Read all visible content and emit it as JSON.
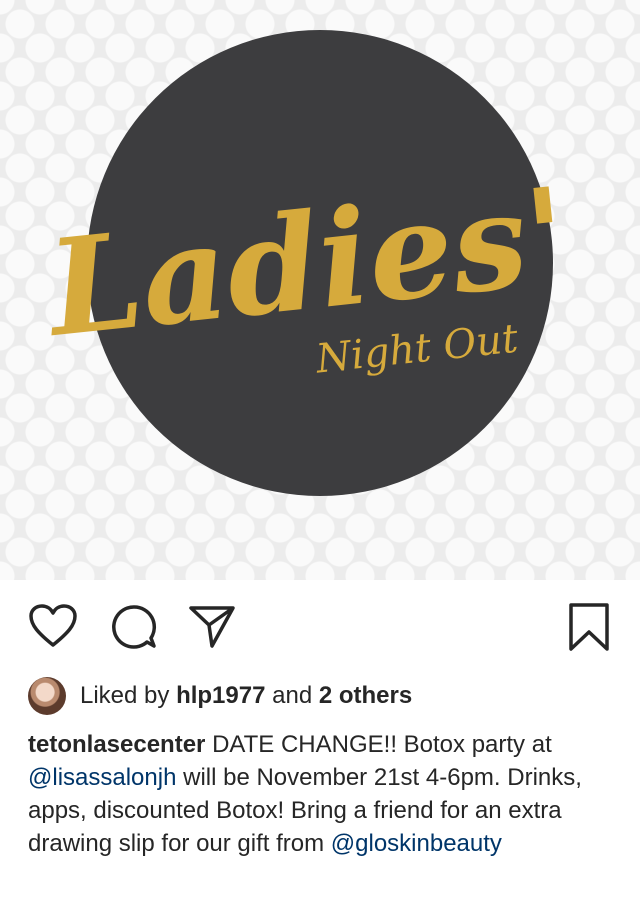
{
  "post": {
    "image": {
      "artwork_text_main": "Ladies'",
      "artwork_text_sub": "Night Out",
      "colors": {
        "circle": "#3d3d3f",
        "gold": "#d6aa3c",
        "background": "#ececec"
      }
    }
  },
  "actions": {
    "icons": [
      "heart-icon",
      "comment-icon",
      "send-icon",
      "bookmark-icon"
    ]
  },
  "likes": {
    "prefix": "Liked by",
    "user": "hlp1977",
    "joiner": "and",
    "others": "2 others"
  },
  "caption": {
    "username": "tetonlasecenter",
    "text_1": "DATE CHANGE!! Botox party at",
    "mention_1": "@lisassalonjh",
    "text_2": "will be November 21st 4-6pm. Drinks, apps, discounted Botox! Bring a friend for an extra drawing slip for our gift from",
    "mention_2": "@gloskinbeauty"
  }
}
